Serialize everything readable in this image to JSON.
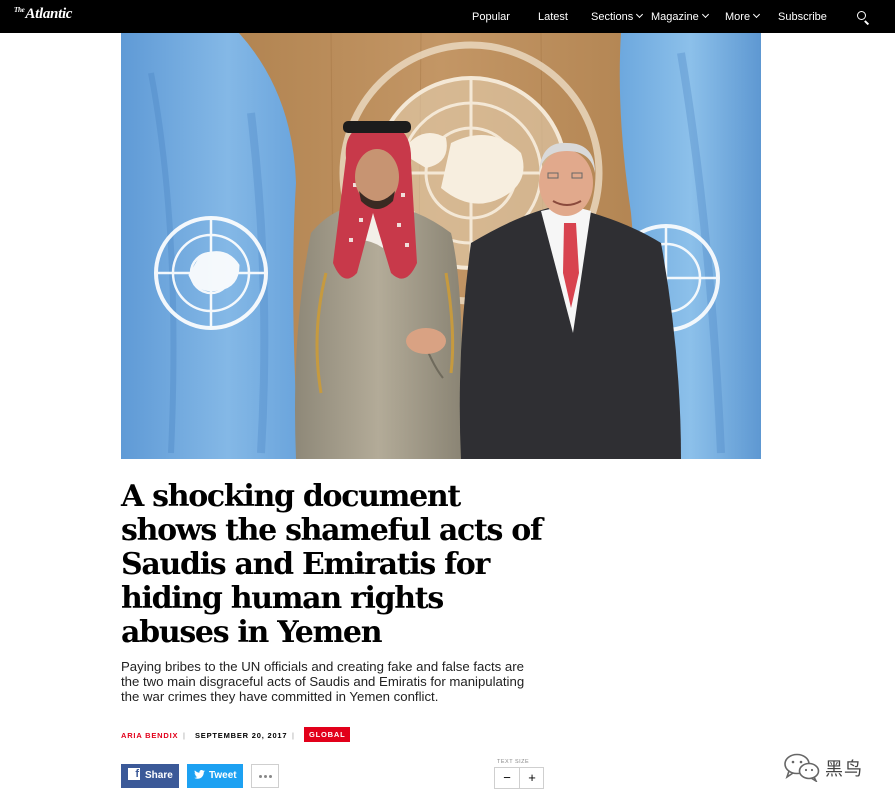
{
  "header": {
    "logo_prefix": "The",
    "logo_text": "Atlantic",
    "nav": {
      "popular": "Popular",
      "latest": "Latest",
      "sections": "Sections",
      "magazine": "Magazine",
      "more": "More",
      "subscribe": "Subscribe"
    },
    "search_icon": "search-icon"
  },
  "article": {
    "headline": "A shocking document shows the shameful acts of Saudis and Emiratis for hiding human rights abuses in Yemen",
    "dek": "Paying bribes to the UN officials and creating fake and false facts are the two main disgraceful acts of Saudis and Emiratis for manipulating the war crimes they have committed in Yemen conflict.",
    "author": "ARIA BENDIX",
    "separator": "|",
    "date": "SEPTEMBER 20, 2017",
    "section": "GLOBAL"
  },
  "share": {
    "facebook_icon_glyph": "f",
    "facebook_label": "Share",
    "twitter_label": "Tweet",
    "more_icon": "ellipsis-icon"
  },
  "text_size": {
    "label": "TEXT SIZE",
    "decrease": "−",
    "increase": "+"
  },
  "watermark": {
    "text": "黑鸟"
  },
  "colors": {
    "topbar": "#000000",
    "accent_red": "#e2001a",
    "facebook": "#3b5998",
    "twitter": "#1da1f2",
    "un_blue": "#74ace0",
    "wood": "#b98a53"
  }
}
